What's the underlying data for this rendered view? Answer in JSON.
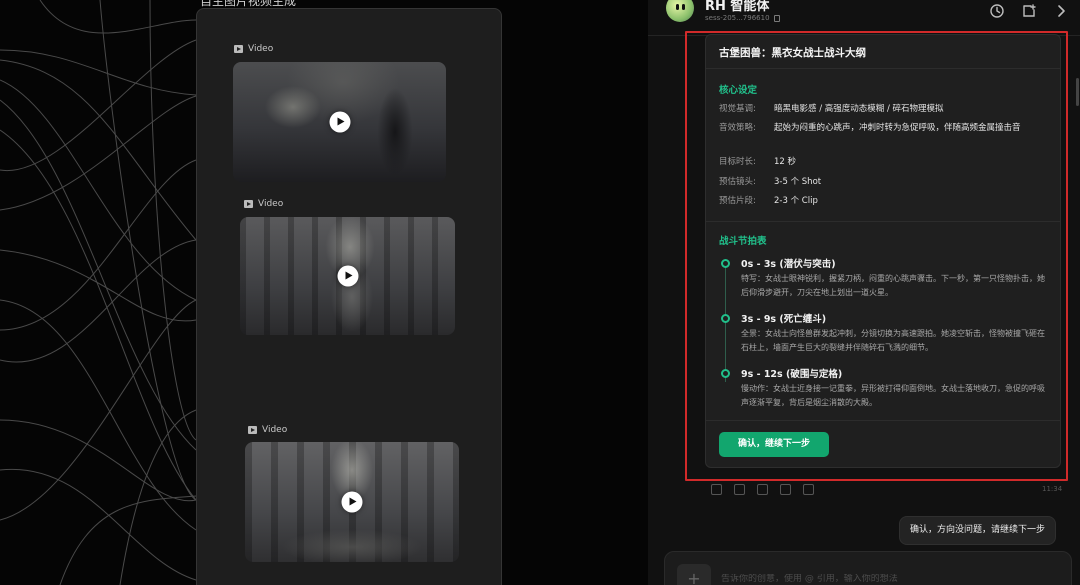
{
  "canvas": {
    "node_title": "自主图片视频生成",
    "video_nodes": [
      {
        "label": "Video"
      },
      {
        "label": "Video"
      },
      {
        "label": "Video"
      }
    ]
  },
  "chat": {
    "agent_name": "RH 智能体",
    "session_id": "sess-205...796610",
    "outline": {
      "title": "古堡困兽：黑衣女战士战斗大纲",
      "core_section_title": "核心设定",
      "settings": [
        {
          "key": "视觉基调:",
          "value": "暗黑电影感 / 高强度动态模糊 / 碎石物理模拟"
        },
        {
          "key": "音效策略:",
          "value": "起始为闷重的心跳声，冲刺时转为急促呼吸，伴随高频金属撞击音"
        },
        {
          "key": "目标时长:",
          "value": "12 秒"
        },
        {
          "key": "预估镜头:",
          "value": "3-5 个 Shot"
        },
        {
          "key": "预估片段:",
          "value": "2-3 个 Clip"
        }
      ],
      "beats_section_title": "战斗节拍表",
      "beats": [
        {
          "title": "0s - 3s (潜伏与突击)",
          "desc": "特写：女战士眼神锐利，握紧刀柄，闷重的心跳声骤击。下一秒，第一只怪物扑击，她后仰滑步避开，刀尖在地上划出一道火星。"
        },
        {
          "title": "3s - 9s (死亡缠斗)",
          "desc": "全景：女战士向怪兽群发起冲刺，分镜切换为高速跟拍。她凌空斩击，怪物被撞飞砸在石柱上，墙面产生巨大的裂缝并伴随碎石飞溅的细节。"
        },
        {
          "title": "9s - 12s (破围与定格)",
          "desc": "慢动作：女战士近身接一记重拳，异形被打得仰面倒地。女战士落地收刀，急促的呼吸声逐渐平复，背后是烟尘消散的大殿。"
        }
      ],
      "confirm_label": "确认，继续下一步"
    },
    "message_time": "11:34",
    "user_message": "确认，方向没问题，请继续下一步",
    "input_placeholder": "告诉你的创意，使用 @ 引用，输入你的想法"
  }
}
